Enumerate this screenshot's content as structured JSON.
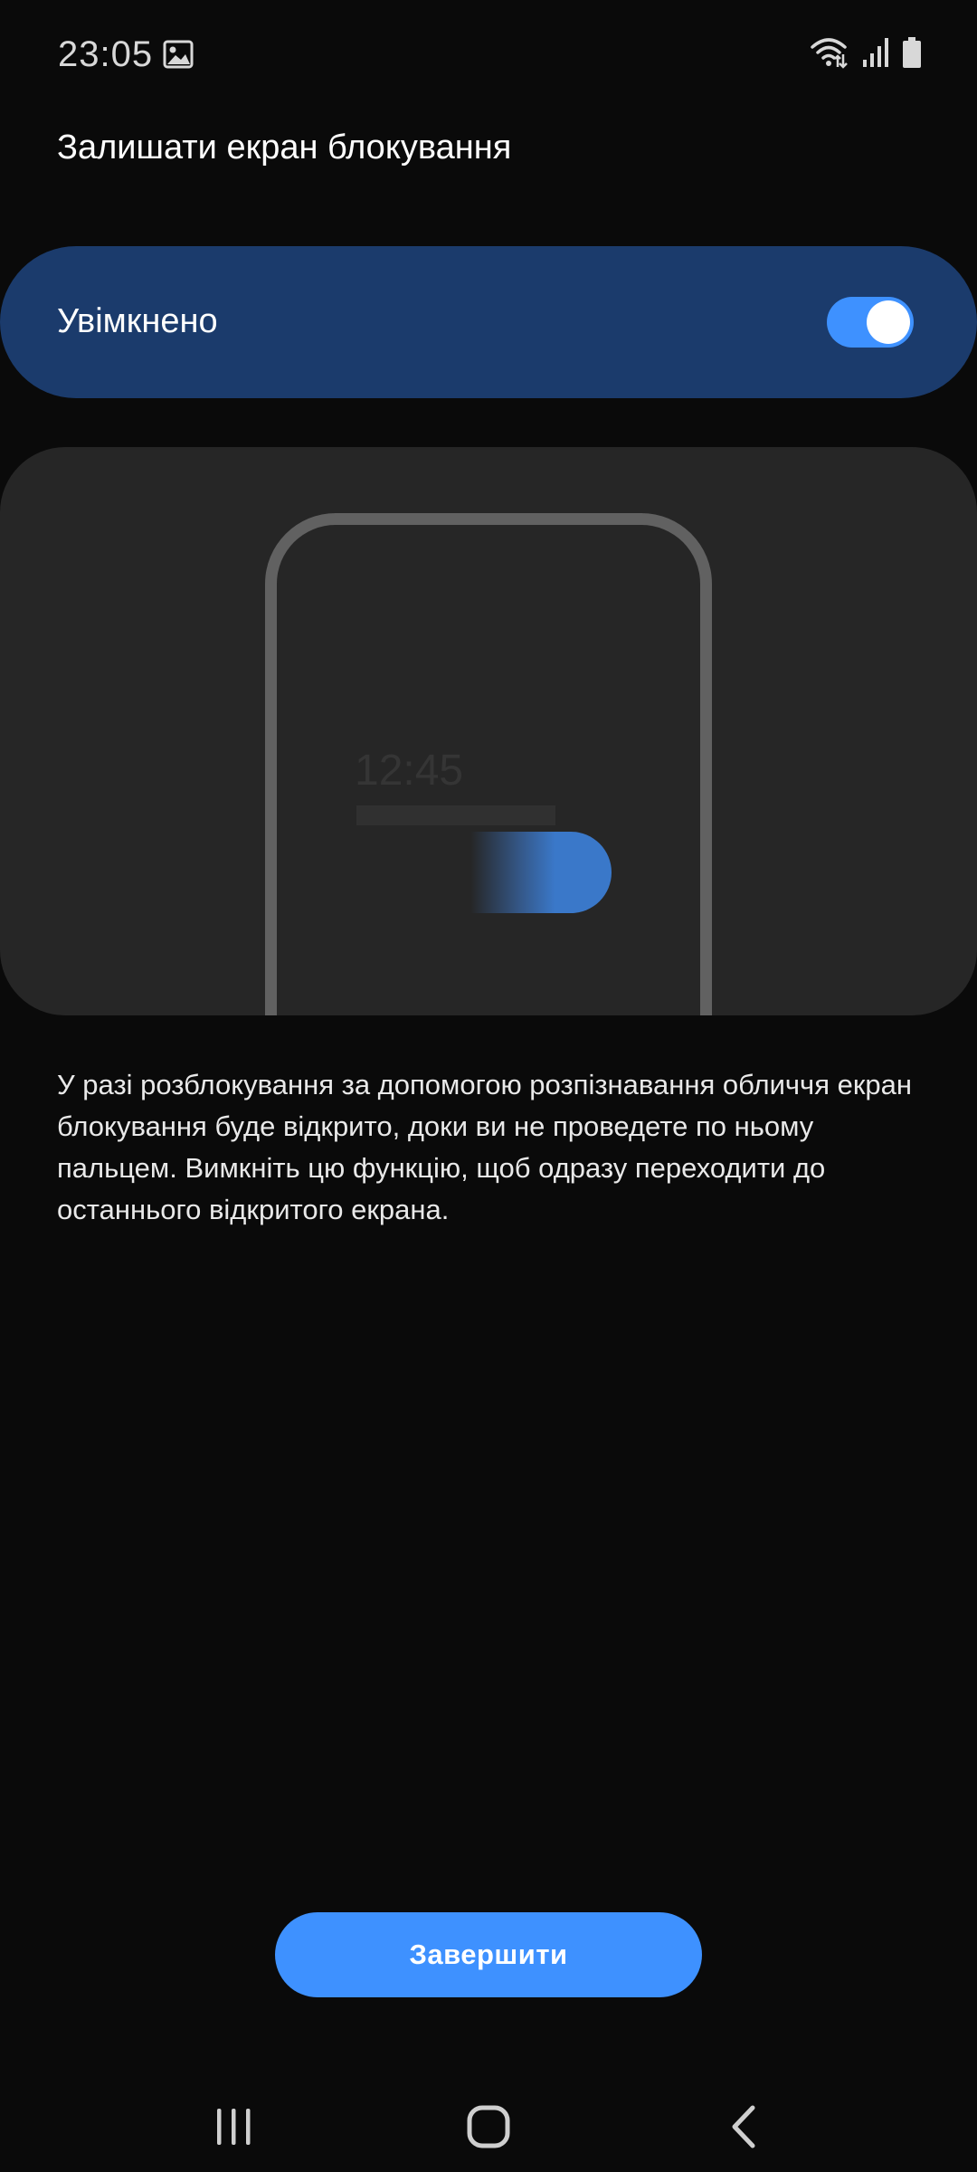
{
  "status_bar": {
    "time": "23:05",
    "icons": [
      "gallery-icon",
      "wifi-icon",
      "signal-icon",
      "battery-icon"
    ]
  },
  "page": {
    "title": "Залишати екран блокування"
  },
  "master_switch": {
    "label": "Увімкнено",
    "state": "on",
    "color": "#3e91ff",
    "bar_color": "#1b3b6c"
  },
  "illustration": {
    "clock_text": "12:45"
  },
  "description": "У разі розблокування за допомогою розпізнавання обличчя екран блокування буде відкрито, доки ви не проведете по ньому пальцем. Вимкніть цю функцію, щоб одразу переходити до останнього відкритого екрана.",
  "footer": {
    "finish_label": "Завершити"
  },
  "nav_bar": {
    "buttons": [
      "recents-icon",
      "home-icon",
      "back-icon"
    ]
  }
}
